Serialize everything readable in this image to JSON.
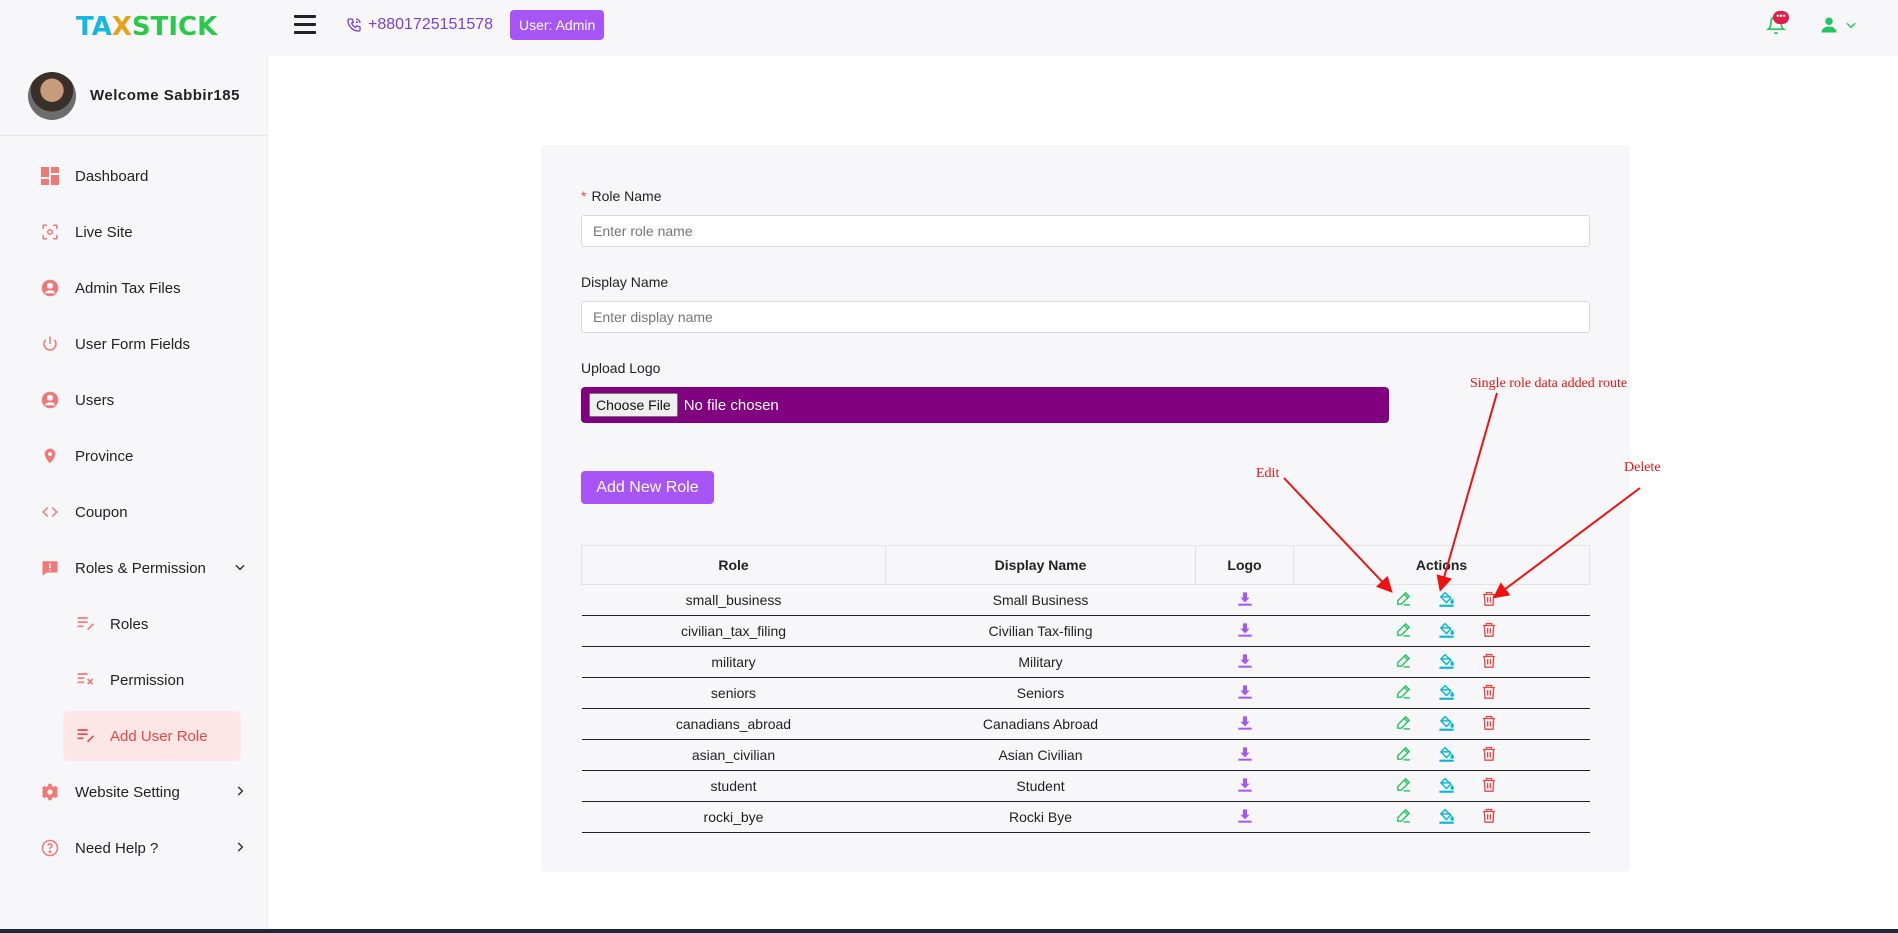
{
  "brand": {
    "part1": "TA",
    "part2": "X",
    "part3": "STICK"
  },
  "header": {
    "phone": "+8801725151578",
    "user_badge": "User:  Admin",
    "notification_count": "•••"
  },
  "sidebar": {
    "welcome": "Welcome Sabbir185",
    "items": [
      {
        "label": "Dashboard",
        "icon": "dashboard-icon"
      },
      {
        "label": "Live Site",
        "icon": "live-site-icon"
      },
      {
        "label": "Admin Tax Files",
        "icon": "user-circle-icon"
      },
      {
        "label": "User Form Fields",
        "icon": "power-icon"
      },
      {
        "label": "Users",
        "icon": "user-circle-icon"
      },
      {
        "label": "Province",
        "icon": "location-pin-icon"
      },
      {
        "label": "Coupon",
        "icon": "code-icon"
      },
      {
        "label": "Roles & Permission",
        "icon": "alert-icon"
      }
    ],
    "sub_items": [
      {
        "label": "Roles",
        "icon": "edit-list-icon"
      },
      {
        "label": "Permission",
        "icon": "check-list-icon"
      },
      {
        "label": "Add User Role",
        "icon": "edit-list-icon",
        "active": true
      }
    ],
    "bottom_items": [
      {
        "label": "Website Setting",
        "icon": "gear-icon"
      },
      {
        "label": "Need Help ?",
        "icon": "help-icon"
      }
    ]
  },
  "form": {
    "role_name_label": "Role Name",
    "role_name_placeholder": "Enter role name",
    "display_name_label": "Display Name",
    "display_name_placeholder": "Enter display name",
    "upload_logo_label": "Upload Logo",
    "choose_file": "Choose File",
    "no_file": "No file chosen",
    "add_button": "Add New Role"
  },
  "table": {
    "headers": [
      "Role",
      "Display Name",
      "Logo",
      "Actions"
    ],
    "rows": [
      {
        "role": "small_business",
        "display": "Small Business"
      },
      {
        "role": "civilian_tax_filing",
        "display": "Civilian Tax-filing"
      },
      {
        "role": "military",
        "display": "Military"
      },
      {
        "role": "seniors",
        "display": "Seniors"
      },
      {
        "role": "canadians_abroad",
        "display": "Canadians Abroad"
      },
      {
        "role": "asian_civilian",
        "display": "Asian Civilian"
      },
      {
        "role": "student",
        "display": "Student"
      },
      {
        "role": "rocki_bye",
        "display": "Rocki Bye"
      }
    ]
  },
  "annotations": {
    "edit": "Edit",
    "single": "Single role data added route",
    "delete": "Delete"
  },
  "colors": {
    "accent": "#a855f7",
    "file_bg": "#800080",
    "danger": "#ef4444",
    "green": "#22c55e",
    "cyan": "#06b6d4",
    "annotation": "#ef1111"
  }
}
